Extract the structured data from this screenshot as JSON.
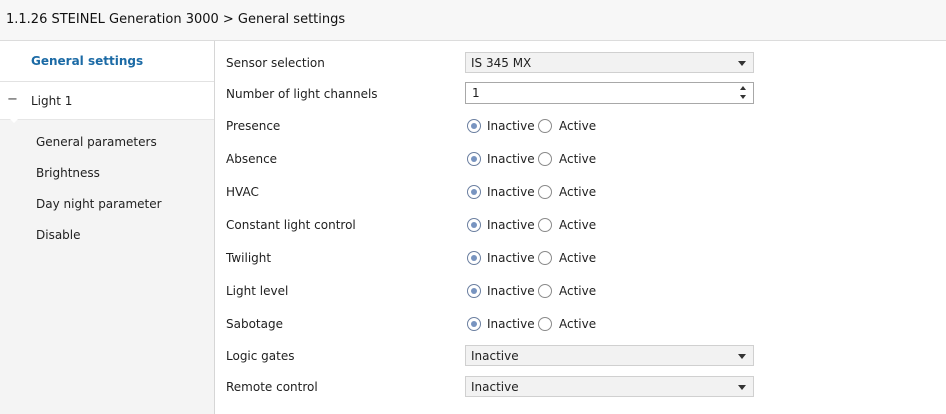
{
  "header": {
    "title": "1.1.26 STEINEL Generation 3000 > General settings"
  },
  "sidebar": {
    "general": "General settings",
    "light": {
      "toggle": "−",
      "label": "Light 1"
    },
    "subitems": [
      "General parameters",
      "Brightness",
      "Day night parameter",
      "Disable"
    ]
  },
  "settings": {
    "sensor_selection": {
      "label": "Sensor selection",
      "value": "IS 345 MX"
    },
    "light_channels": {
      "label": "Number of light channels",
      "value": "1"
    },
    "radio_options": {
      "inactive": "Inactive",
      "active": "Active"
    },
    "radios": [
      {
        "label": "Presence",
        "selected": "Inactive"
      },
      {
        "label": "Absence",
        "selected": "Inactive"
      },
      {
        "label": "HVAC",
        "selected": "Inactive"
      },
      {
        "label": "Constant light control",
        "selected": "Inactive"
      },
      {
        "label": "Twilight",
        "selected": "Inactive"
      },
      {
        "label": "Light level",
        "selected": "Inactive"
      },
      {
        "label": "Sabotage",
        "selected": "Inactive"
      }
    ],
    "logic_gates": {
      "label": "Logic gates",
      "value": "Inactive"
    },
    "remote_control": {
      "label": "Remote control",
      "value": "Inactive"
    }
  }
}
